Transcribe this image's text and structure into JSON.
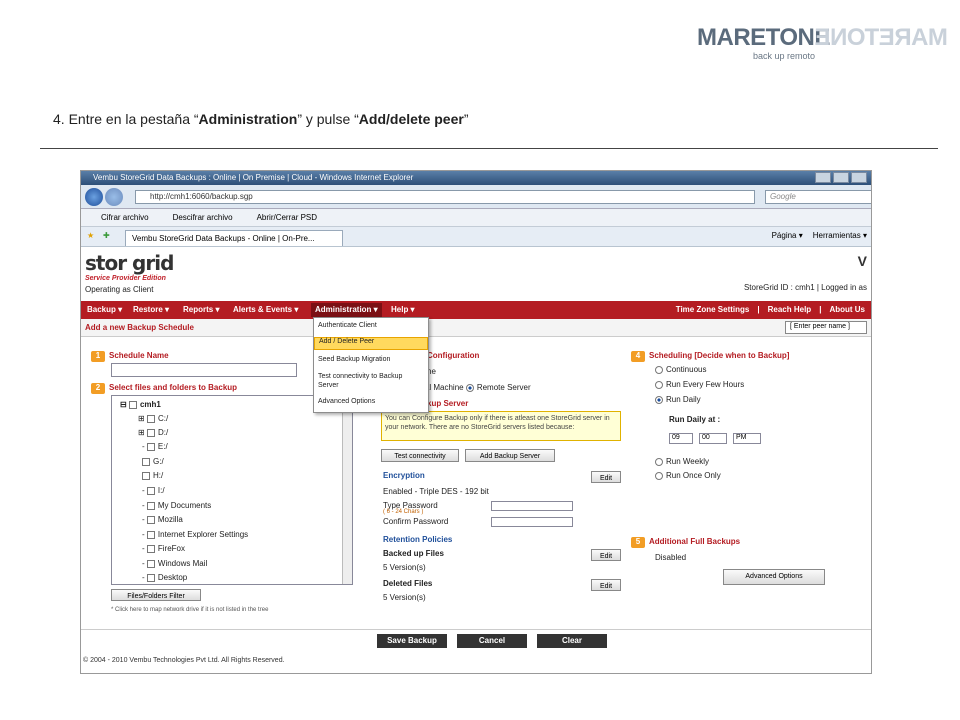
{
  "logo": {
    "main": "MARETONE",
    "mirror": "MARETONE",
    "tagline": "back up remoto"
  },
  "instruction": {
    "prefix": "4. Entre en la pestaña “",
    "tab": "Administration",
    "middle": "” y pulse “",
    "item": "Add/delete peer",
    "suffix": "”"
  },
  "window": {
    "title": "Vembu StoreGrid Data Backups : Online | On Premise | Cloud - Windows Internet Explorer",
    "address": "http://cmh1:6060/backup.sgp",
    "search_placeholder": "Google",
    "ie_toolbar": [
      "Cifrar archivo",
      "Descifrar archivo",
      "Abrir/Cerrar PSD"
    ],
    "tab": "Vembu StoreGrid Data Backups - Online | On-Pre...",
    "tools": [
      "Página ▾",
      "Herramientas ▾"
    ]
  },
  "app": {
    "brand": "stor grid",
    "edition": "Service Provider Edition",
    "operating": "Operating as Client",
    "storegrid_id": "StoreGrid ID : cmh1  |  Logged in as",
    "menu": [
      "Backup ▾",
      "Restore ▾",
      "Reports ▾",
      "Alerts & Events ▾",
      "Administration ▾",
      "Help ▾"
    ],
    "menu_right": [
      "Time Zone Settings",
      "Reach Help",
      "About Us"
    ],
    "subtitle": "Add a new Backup Schedule",
    "peer_select": "[ Enter peer name ]"
  },
  "dropdown": [
    "Authenticate Client",
    "Add / Delete Peer",
    "Seed Backup Migration",
    "Test connectivity to Backup Server",
    "Advanced Options"
  ],
  "left": {
    "schedule_name": "Schedule Name",
    "files": "Select files and folders to Backup",
    "tree": [
      "cmh1",
      "C:/",
      "D:/",
      "E:/",
      "G:/",
      "H:/",
      "I:/",
      "My Documents",
      "Mozilla",
      "Internet Explorer Settings",
      "FireFox",
      "Windows Mail",
      "Desktop"
    ],
    "filter_btn": "Files/Folders Filter",
    "note": "* Click here to map network drive if it is not listed in the tree"
  },
  "middle": {
    "config": "Configuration",
    "local_label": "ne",
    "mode": [
      "Local Machine",
      "Remote Server"
    ],
    "server": "kup Server",
    "warning": "You can Configure Backup only if there is atleast one StoreGrid server in your network. There are no StoreGrid servers listed because:",
    "test_btn": "Test connectivity",
    "add_btn": "Add Backup Server",
    "encryption": "Encryption",
    "enabled": "Enabled - Triple DES - 192 bit",
    "type_pw": "Type Password",
    "pw_hint": "( 6 - 24 Chars )",
    "confirm_pw": "Confirm Password",
    "retention": "Retention Policies",
    "backed": "Backed up Files",
    "backed_val": "5  Version(s)",
    "deleted": "Deleted Files",
    "deleted_val": "5  Version(s)",
    "edit": "Edit"
  },
  "right": {
    "scheduling": "Scheduling [Decide when to Backup]",
    "options": [
      "Continuous",
      "Run Every Few Hours",
      "Run Daily",
      "Run Weekly",
      "Run Once Only"
    ],
    "run_daily_at": "Run Daily at :",
    "hour": "09",
    "minute": "00",
    "ampm": "PM",
    "additional": "Additional Full Backups",
    "disabled": "Disabled",
    "adv_btn": "Advanced Options"
  },
  "footer": {
    "buttons": [
      "Save Backup",
      "Cancel",
      "Clear"
    ],
    "copyright": "© 2004 - 2010 Vembu Technologies Pvt Ltd. All Rights Reserved."
  },
  "colors": {
    "brand_red": "#b41c22",
    "highlight": "#ffd95e",
    "step_orange": "#f29d25"
  }
}
